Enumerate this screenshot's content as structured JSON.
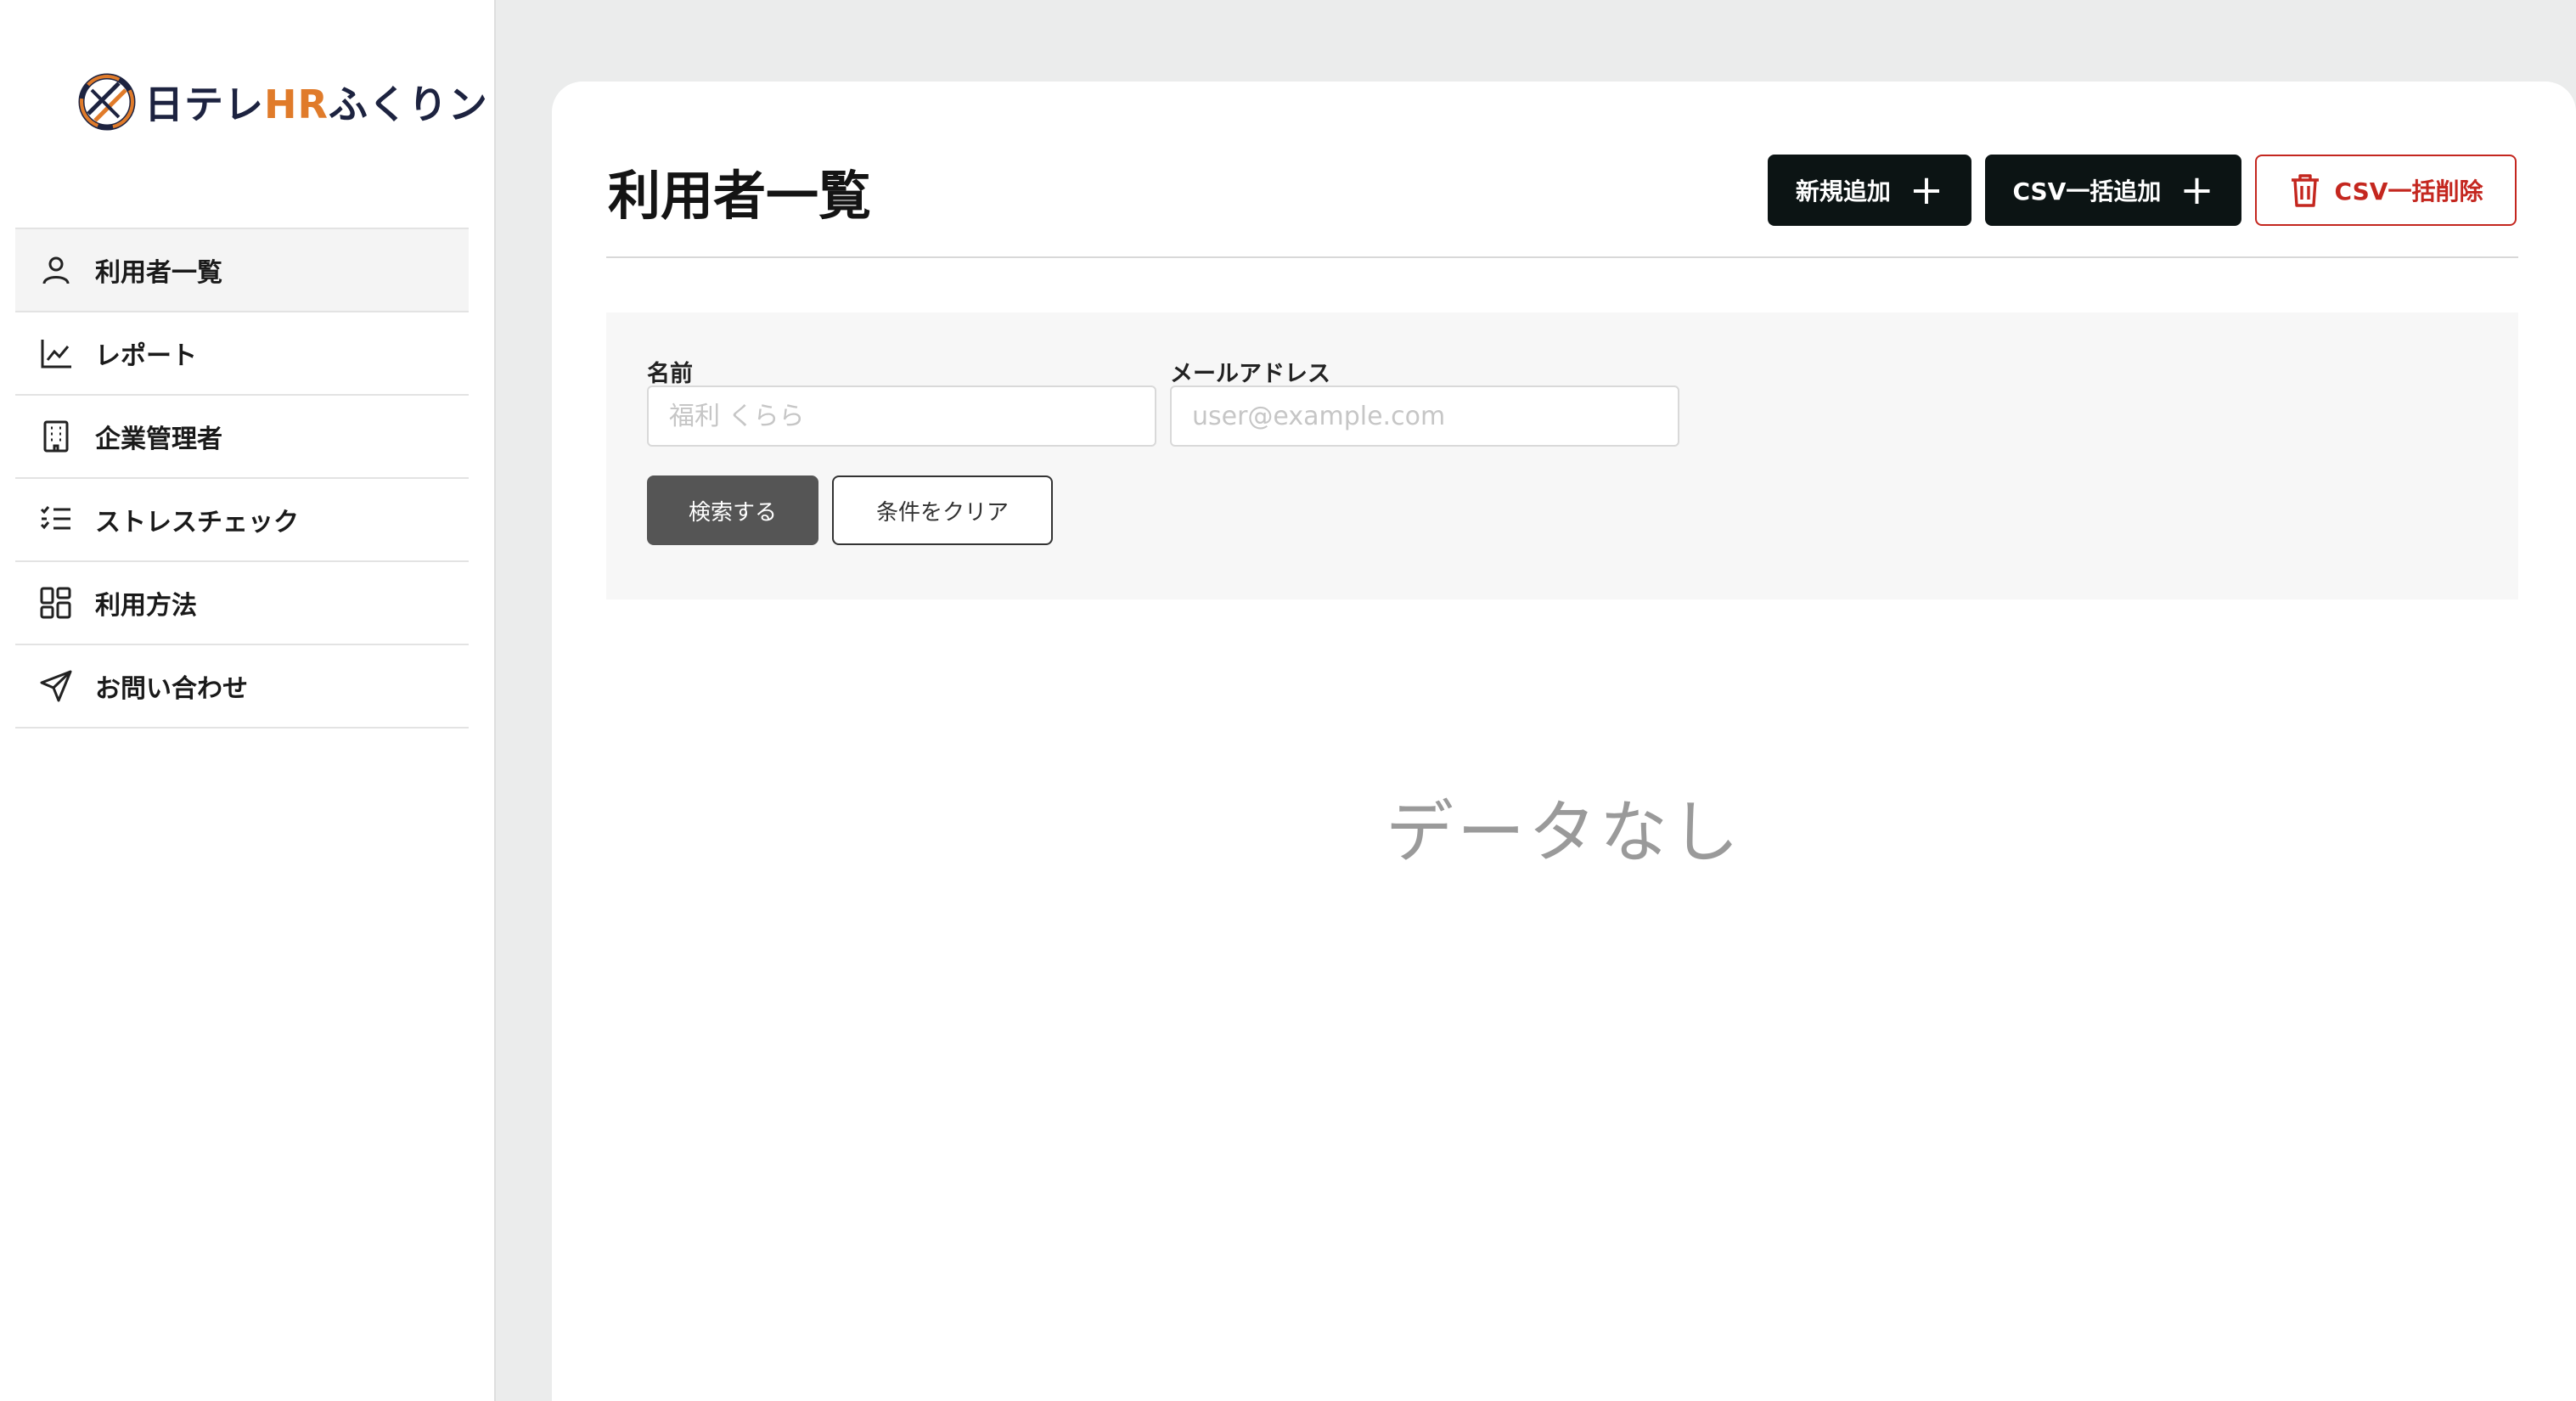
{
  "brand": {
    "name_prefix": "日テレ",
    "name_accent": "HR",
    "name_suffix": "ふくりン",
    "accent_color": "#e07b2a",
    "navy_color": "#1d2340"
  },
  "sidebar": {
    "items": [
      {
        "label": "利用者一覧",
        "icon": "user-icon",
        "active": true
      },
      {
        "label": "レポート",
        "icon": "line-chart-icon",
        "active": false
      },
      {
        "label": "企業管理者",
        "icon": "building-icon",
        "active": false
      },
      {
        "label": "ストレスチェック",
        "icon": "checklist-icon",
        "active": false
      },
      {
        "label": "利用方法",
        "icon": "grid-icon",
        "active": false
      },
      {
        "label": "お問い合わせ",
        "icon": "send-icon",
        "active": false
      }
    ]
  },
  "main": {
    "title": "利用者一覧",
    "actions": {
      "add_new": "新規追加",
      "csv_bulk_add": "CSV一括追加",
      "csv_bulk_delete": "CSV一括削除"
    },
    "search": {
      "name_label": "名前",
      "name_placeholder": "福利 くらら",
      "email_label": "メールアドレス",
      "email_placeholder": "user@example.com",
      "search_button": "検索する",
      "clear_button": "条件をクリア"
    },
    "empty_text": "データなし"
  },
  "colors": {
    "danger": "#c4271f",
    "primary_dark": "#0c1414",
    "page_bg": "#ebecec"
  }
}
